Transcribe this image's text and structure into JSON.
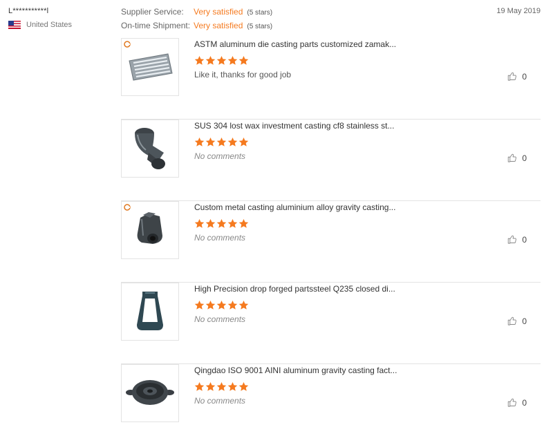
{
  "reviewer": {
    "name": "L***********l",
    "country": "United States",
    "flag_icon": "us-flag-icon"
  },
  "ratings": [
    {
      "label": "Supplier Service:",
      "value": "Very satisfied",
      "stars": "(5 stars)"
    },
    {
      "label": "On-time Shipment:",
      "value": "Very satisfied",
      "stars": "(5 stars)"
    }
  ],
  "date": "19 May 2019",
  "accent_color": "#f57a1f",
  "items": [
    {
      "title": "ASTM aluminum die casting parts customized zamak...",
      "rating": 5,
      "comment": "Like it, thanks for good job",
      "likes": "0",
      "image_icon": "die-cast-plate-image"
    },
    {
      "title": "SUS 304 lost wax investment casting cf8 stainless st...",
      "rating": 5,
      "comment": "No comments",
      "likes": "0",
      "image_icon": "pipe-elbow-image"
    },
    {
      "title": "Custom metal casting aluminium alloy gravity casting...",
      "rating": 5,
      "comment": "No comments",
      "likes": "0",
      "image_icon": "housing-casting-image"
    },
    {
      "title": "High Precision drop forged partssteel Q235 closed di...",
      "rating": 5,
      "comment": "No comments",
      "likes": "0",
      "image_icon": "forged-bracket-image"
    },
    {
      "title": "Qingdao ISO 9001 AINI aluminum gravity casting fact...",
      "rating": 5,
      "comment": "No comments",
      "likes": "0",
      "image_icon": "round-cover-image"
    }
  ]
}
